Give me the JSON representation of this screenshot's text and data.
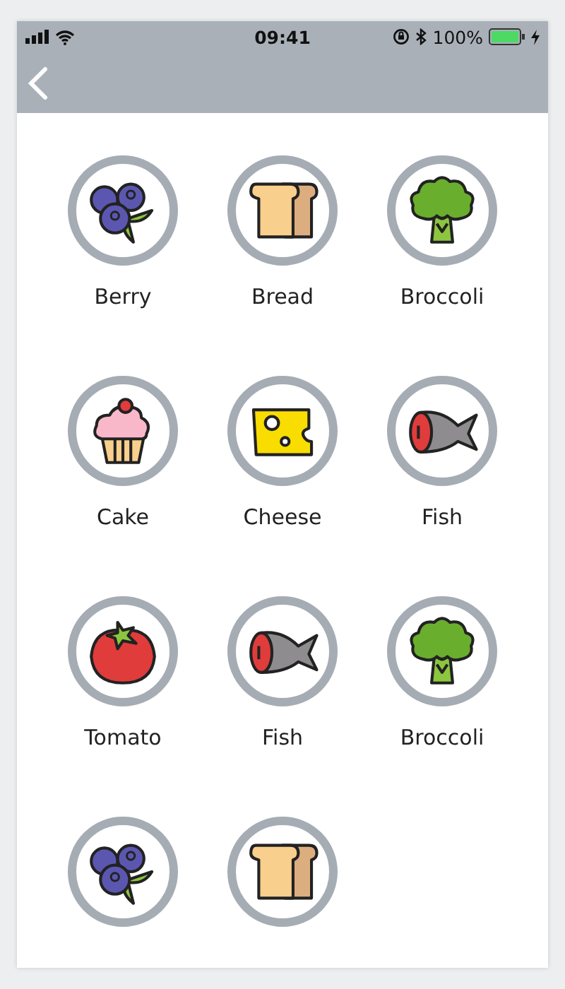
{
  "status_bar": {
    "time": "09:41",
    "battery": "100%"
  },
  "items": [
    {
      "kind": "berry",
      "label": "Berry"
    },
    {
      "kind": "bread",
      "label": "Bread"
    },
    {
      "kind": "broccoli",
      "label": "Broccoli"
    },
    {
      "kind": "cake",
      "label": "Cake"
    },
    {
      "kind": "cheese",
      "label": "Cheese"
    },
    {
      "kind": "fish",
      "label": "Fish"
    },
    {
      "kind": "tomato",
      "label": "Tomato"
    },
    {
      "kind": "fish",
      "label": "Fish"
    },
    {
      "kind": "broccoli",
      "label": "Broccoli"
    },
    {
      "kind": "berry"
    },
    {
      "kind": "bread"
    }
  ]
}
